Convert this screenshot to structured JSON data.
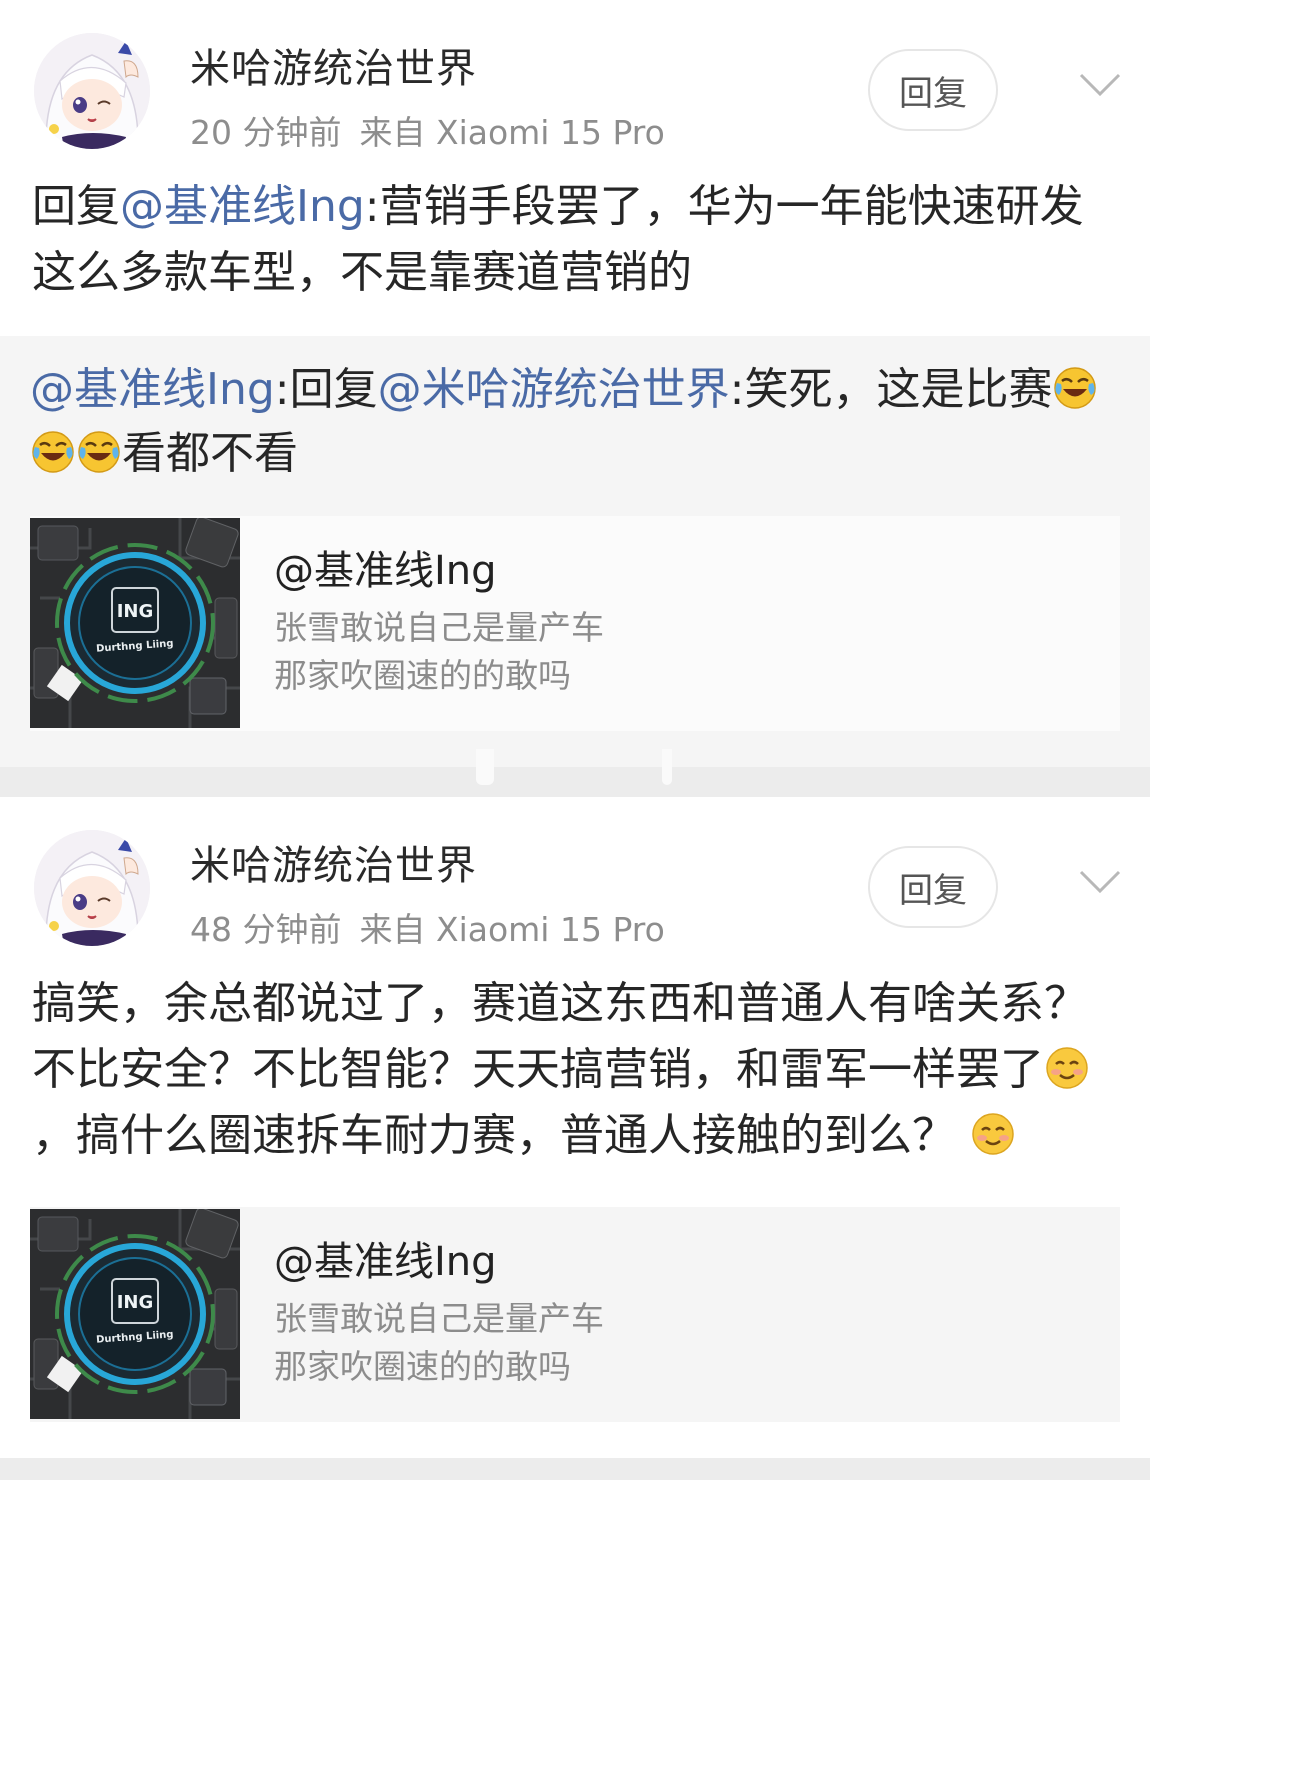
{
  "comments": [
    {
      "username": "米哈游统治世界",
      "time": "20 分钟前",
      "source": "来自 Xiaomi 15 Pro",
      "reply_label": "回复",
      "text_prefix": "回复",
      "text_mention": "@基准线Ing",
      "text_body": ":营销手段罢了，华为一年能快速研发这么多款车型，不是靠赛道营销的",
      "quote": {
        "mention1": "@基准线Ing",
        "mid": ":回复",
        "mention2": "@米哈游统治世界",
        "text": ":笑死，这是比赛",
        "text_after": "看都不看"
      },
      "card": {
        "name": "@基准线Ing",
        "desc_line1": "张雪敢说自己是量产车",
        "desc_line2": "那家吹圈速的的敢吗",
        "image_text1": "ING",
        "image_text2": "Durthng Liing"
      }
    },
    {
      "username": "米哈游统治世界",
      "time": "48 分钟前",
      "source": "来自 Xiaomi 15 Pro",
      "reply_label": "回复",
      "text_part1": "搞笑，余总都说过了，赛道这东西和普通人有啥关系？不比安全？不比智能？天天搞营销，和雷军一样罢了",
      "text_part2": "，搞什么圈速拆车耐力赛，普通人接触的到么？",
      "card": {
        "name": "@基准线Ing",
        "desc_line1": "张雪敢说自己是量产车",
        "desc_line2": "那家吹圈速的的敢吗",
        "image_text1": "ING",
        "image_text2": "Durthng Liing"
      }
    }
  ],
  "avatar_text": "miHoYo",
  "icons": [
    "avatar",
    "chevron-down-icon",
    "laugh-cry-emoji-icon",
    "smile-emoji-icon"
  ],
  "colors": {
    "mention": "#4a6aa6",
    "meta": "#8d8d8d",
    "quote_bg": "#f5f5f5",
    "separator": "#ececec"
  }
}
